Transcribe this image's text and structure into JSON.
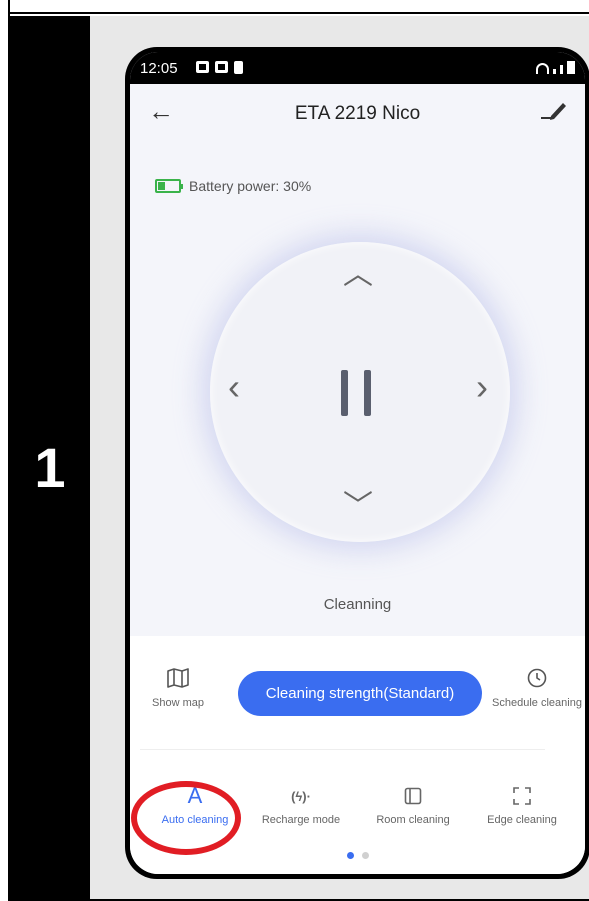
{
  "step": {
    "number": "1"
  },
  "status_bar": {
    "time": "12:05"
  },
  "app_bar": {
    "title": "ETA 2219 Nico"
  },
  "battery": {
    "label": "Battery power: 30%",
    "level_percent": 30,
    "color": "#3ab34a"
  },
  "control": {
    "status_text": "Cleanning"
  },
  "panel": {
    "show_map_label": "Show map",
    "strength_button_label": "Cleaning strength(Standard)",
    "schedule_label": "Schedule cleaning",
    "modes": [
      {
        "label": "Auto cleaning",
        "icon_text": "A",
        "active": true
      },
      {
        "label": "Recharge mode",
        "icon_text": "(ϟ)·",
        "active": false
      },
      {
        "label": "Room cleaning",
        "active": false
      },
      {
        "label": "Edge cleaning",
        "active": false
      }
    ],
    "page_count": 2,
    "active_page": 1
  },
  "colors": {
    "accent": "#3a6df0",
    "highlight": "#e11d24",
    "step_background": "#000000"
  }
}
